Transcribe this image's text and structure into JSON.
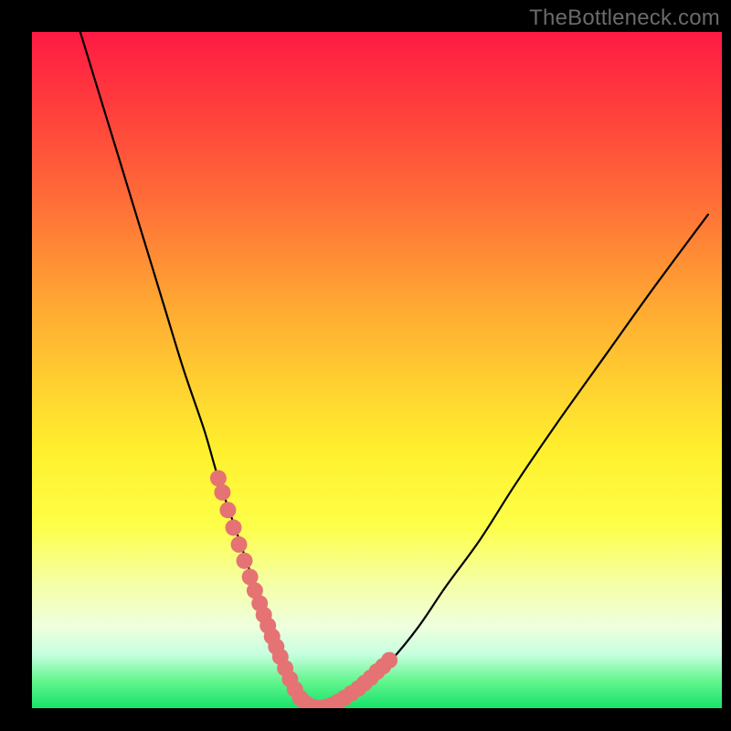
{
  "watermark": "TheBottleneck.com",
  "chart_data": {
    "type": "line",
    "title": "",
    "xlabel": "",
    "ylabel": "",
    "xlim": [
      0,
      100
    ],
    "ylim": [
      0,
      100
    ],
    "series": [
      {
        "name": "bottleneck-curve",
        "x": [
          7,
          10,
          13,
          16,
          19,
          22,
          25,
          27,
          29,
          31,
          33,
          34.5,
          36,
          37.5,
          39,
          41,
          43,
          45,
          48,
          52,
          56,
          60,
          65,
          70,
          76,
          83,
          90,
          98
        ],
        "y": [
          100,
          90,
          80,
          70,
          60,
          50,
          41,
          34,
          28,
          22,
          16,
          12,
          8,
          4,
          1,
          0,
          0,
          1,
          3,
          7,
          12,
          18,
          25,
          33,
          42,
          52,
          62,
          73
        ]
      }
    ],
    "markers": {
      "name": "highlight-dots",
      "color": "#e57373",
      "x": [
        27.0,
        27.6,
        28.4,
        29.2,
        30.0,
        30.8,
        31.6,
        32.3,
        33.0,
        33.6,
        34.2,
        34.8,
        35.4,
        36.0,
        36.7,
        37.4,
        38.1,
        38.9,
        39.7,
        40.6,
        41.5,
        42.4,
        43.3,
        44.3,
        45.3,
        46.3,
        47.3,
        48.2,
        49.1,
        50.0,
        50.9,
        51.8
      ],
      "y": [
        34.0,
        31.9,
        29.3,
        26.7,
        24.2,
        21.8,
        19.4,
        17.4,
        15.5,
        13.8,
        12.2,
        10.6,
        9.1,
        7.6,
        5.9,
        4.3,
        2.8,
        1.5,
        0.7,
        0.2,
        0.0,
        0.1,
        0.4,
        0.9,
        1.5,
        2.2,
        2.9,
        3.7,
        4.5,
        5.4,
        6.2,
        7.1
      ]
    },
    "gradient_colors": {
      "top": "#ff1a44",
      "mid": "#fff02e",
      "bottom": "#16e36b"
    }
  }
}
